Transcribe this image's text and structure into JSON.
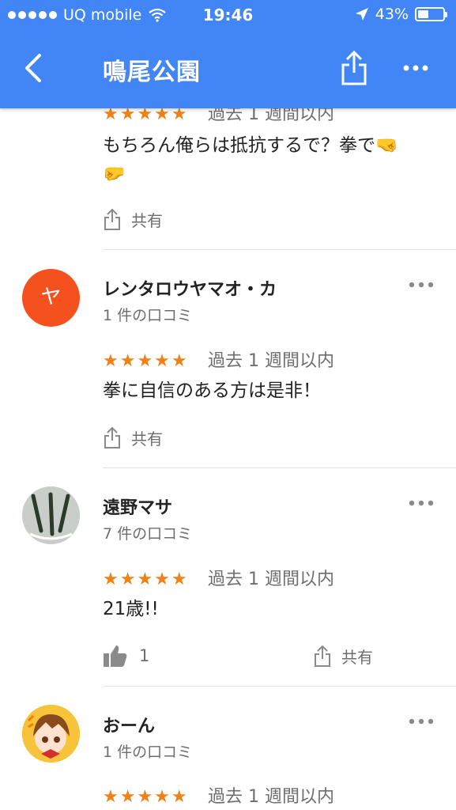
{
  "status_bar": {
    "carrier": "UQ mobile",
    "time": "19:46",
    "battery_percent": "43%",
    "battery_level": 0.43
  },
  "header": {
    "title": "鳴尾公園",
    "back_icon": "chevron-left-icon",
    "share_icon": "share-icon",
    "more_icon": "more-horizontal-icon",
    "background_color": "#4285f4"
  },
  "reviews": [
    {
      "stars": "★★★★★",
      "rating": 5,
      "time_ago": "過去 1 週間以内",
      "text_line1": "もちろん俺らは抵抗するで？拳で🤜",
      "text_line2": "🤛",
      "share_label": "共有"
    },
    {
      "author": "レンタロウヤマオ・カ",
      "avatar_letter": "ヤ",
      "avatar_color": "#f4511e",
      "review_count": "1 件の口コミ",
      "stars": "★★★★★",
      "rating": 5,
      "time_ago": "過去 1 週間以内",
      "text": "拳に自信のある方は是非！",
      "share_label": "共有"
    },
    {
      "author": "遠野マサ",
      "review_count": "7 件の口コミ",
      "stars": "★★★★★",
      "rating": 5,
      "time_ago": "過去 1 週間以内",
      "text": "21歳!!",
      "like_count": "1",
      "share_label": "共有"
    },
    {
      "author": "おーん",
      "review_count": "1 件の口コミ",
      "stars": "★★★★★",
      "rating": 5,
      "time_ago": "過去 1 週間以内"
    }
  ],
  "colors": {
    "star": "#f08018",
    "secondary_text": "#6e6e6e"
  }
}
